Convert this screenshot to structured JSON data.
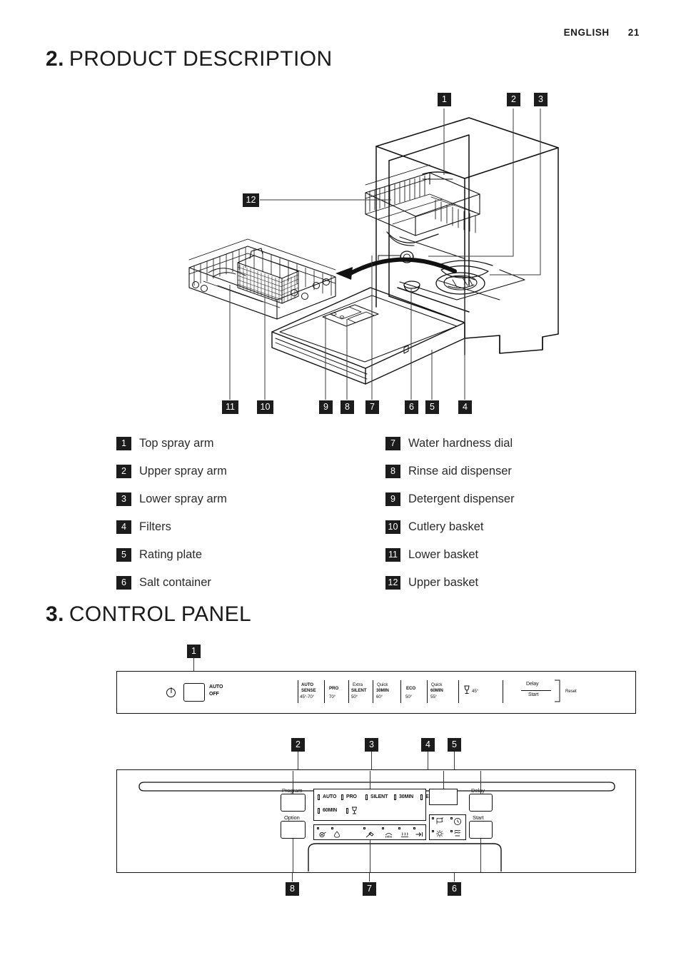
{
  "header": {
    "language": "ENGLISH",
    "page_number": "21"
  },
  "sections": {
    "product_description": {
      "number": "2.",
      "title": "PRODUCT DESCRIPTION"
    },
    "control_panel": {
      "number": "3.",
      "title": "CONTROL PANEL"
    }
  },
  "legend": {
    "left": [
      {
        "n": "1",
        "label": "Top spray arm"
      },
      {
        "n": "2",
        "label": "Upper spray arm"
      },
      {
        "n": "3",
        "label": "Lower spray arm"
      },
      {
        "n": "4",
        "label": "Filters"
      },
      {
        "n": "5",
        "label": "Rating plate"
      },
      {
        "n": "6",
        "label": "Salt container"
      }
    ],
    "right": [
      {
        "n": "7",
        "label": "Water hardness dial"
      },
      {
        "n": "8",
        "label": "Rinse aid dispenser"
      },
      {
        "n": "9",
        "label": "Detergent dispenser"
      },
      {
        "n": "10",
        "label": "Cutlery basket"
      },
      {
        "n": "11",
        "label": "Lower basket"
      },
      {
        "n": "12",
        "label": "Upper basket"
      }
    ]
  },
  "illustration_callouts": {
    "top": [
      "1",
      "2",
      "3"
    ],
    "left": [
      "12"
    ],
    "bottom": [
      "11",
      "10",
      "9",
      "8",
      "7",
      "6",
      "5",
      "4"
    ]
  },
  "panel_a": {
    "power_label_line1": "AUTO",
    "power_label_line2": "OFF",
    "programs": [
      {
        "name1": "AUTO",
        "name2": "SENSE",
        "temp": "45°-70°"
      },
      {
        "name1": "PRO",
        "name2": "",
        "temp": "70°"
      },
      {
        "name1": "Extra",
        "name2": "SILENT",
        "temp": "50°"
      },
      {
        "name1": "Quick",
        "name2": "30MIN",
        "temp": "60°"
      },
      {
        "name1": "ECO",
        "name2": "",
        "temp": "50°"
      },
      {
        "name1": "Quick",
        "name2": "60MIN",
        "temp": "55°"
      },
      {
        "name1": "glass-icon",
        "name2": "",
        "temp": "45°"
      }
    ],
    "delay_label": "Delay",
    "start_label": "Start",
    "reset_label": "Reset",
    "callout": "1"
  },
  "panel_b": {
    "program_button_label": "Program",
    "option_button_label": "Option",
    "delay_button_label": "Delay",
    "start_button_label": "Start",
    "display_row1": [
      "AUTO",
      "PRO",
      "SILENT",
      "30MIN",
      "ECO"
    ],
    "display_row2": [
      "60MIN",
      "glass-icon"
    ],
    "status_icons": [
      "salt-icon",
      "rinse-aid-icon",
      "wash-icon",
      "rinse-icon",
      "dry-icon",
      "end-icon"
    ],
    "right_icons": [
      "delay-start-icon",
      "time-icon",
      "drying-icon",
      "multitab-icon"
    ],
    "callouts": {
      "top": [
        "2",
        "3",
        "4",
        "5"
      ],
      "bottom": [
        "8",
        "7",
        "6"
      ]
    }
  }
}
